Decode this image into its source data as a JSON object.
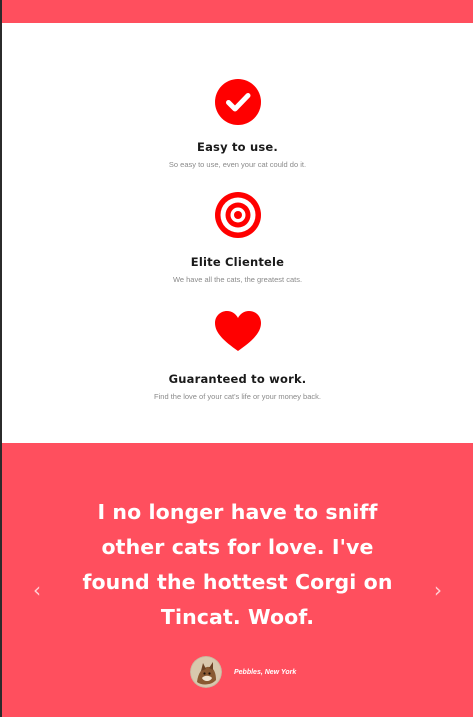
{
  "features": [
    {
      "icon": "check-circle-icon",
      "title": "Easy to use.",
      "description": "So easy to use, even your cat could do it."
    },
    {
      "icon": "bullseye-icon",
      "title": "Elite Clientele",
      "description": "We have all the cats, the greatest cats."
    },
    {
      "icon": "heart-icon",
      "title": "Guaranteed to work.",
      "description": "Find the love of your cat's life or your money back."
    }
  ],
  "testimonial": {
    "quote": "I no longer have to sniff other cats for love. I've found the hottest Corgi on Tincat. Woof.",
    "author": "Pebbles, New York",
    "prev_icon": "chevron-left-icon",
    "next_icon": "chevron-right-icon"
  },
  "colors": {
    "brand": "#ff4f5e",
    "icon_red": "#ff0000",
    "heading": "#1a1a1a",
    "muted": "#8a8a8a"
  }
}
